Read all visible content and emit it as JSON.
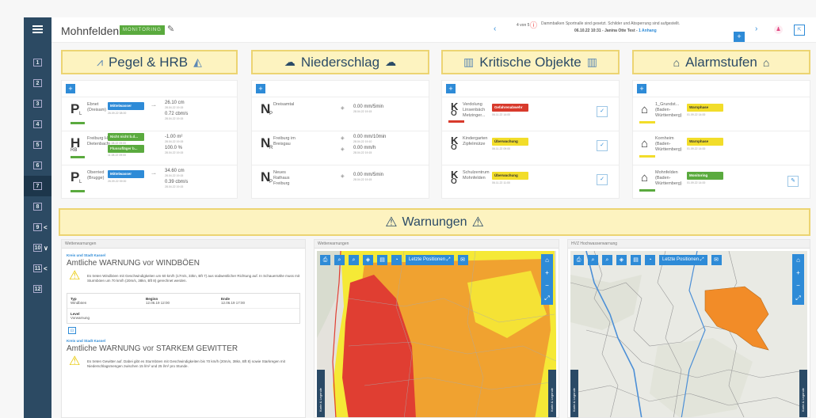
{
  "sidebar": {
    "items": [
      {
        "label": "1",
        "chevron": ""
      },
      {
        "label": "2",
        "chevron": ""
      },
      {
        "label": "3",
        "chevron": ""
      },
      {
        "label": "4",
        "chevron": ""
      },
      {
        "label": "5",
        "chevron": ""
      },
      {
        "label": "6",
        "chevron": ""
      },
      {
        "label": "7",
        "chevron": ""
      },
      {
        "label": "8",
        "chevron": ""
      },
      {
        "label": "9",
        "chevron": "<"
      },
      {
        "label": "10",
        "chevron": "∨"
      },
      {
        "label": "11",
        "chevron": "<"
      },
      {
        "label": "12",
        "chevron": ""
      }
    ]
  },
  "header": {
    "site_title": "Mohnfelden",
    "mode_badge": "MONITORING",
    "message_counter": "4 von 5",
    "message_text": "Dammbalken Sportnalle sind gesetzt. Schilder und Absperrung sind aufgestellt.",
    "message_meta": "06.10.22 10:31 - Janina Otte Test -",
    "message_link": "1 Anhang"
  },
  "categories": {
    "pegel": "Pegel & HRB",
    "niederschlag": "Niederschlag",
    "objekte": "Kritische Objekte",
    "alarm": "Alarmstufen"
  },
  "pegel": [
    {
      "letter": "P",
      "sub": "L",
      "name": "Ebnet",
      "region": "(Dreisam)",
      "badge": "Mittelwasser",
      "badge_date": "26.09.22 08:00",
      "v1": "26.10 cm",
      "d1": "28.04.22 19:15",
      "v2": "0.72 cbm/s",
      "d2": "28.04.22 19:15"
    },
    {
      "letter": "H",
      "sub": "RB",
      "name": "Freiburg HRB",
      "region": "Dietenbach",
      "badge": "Nicht nicht b.d...",
      "badge_date": "11.08.22 09:00",
      "badge2": "Flussufläger b...",
      "badge2_date": "11.08.22 09:00",
      "v1": "-1.00 m²",
      "d1": "28.04.22 19:15",
      "v2": "100.0 %",
      "d2": "28.04.22 19:15"
    },
    {
      "letter": "P",
      "sub": "L",
      "name": "Oberried",
      "region": "(Brugge)",
      "badge": "Mittelwasser",
      "badge_date": "26.09.22 09:00",
      "v1": "34.60 cm",
      "d1": "28.04.22 19:15",
      "v2": "0.39 cbm/s",
      "d2": "28.04.22 19:15"
    }
  ],
  "niederschlag": [
    {
      "letter": "N",
      "sub": "P",
      "name": "Dreisamtal",
      "v1": "0.00 mm/5min",
      "d1": "28.04.22 19:15",
      "v2": "",
      "d2": ""
    },
    {
      "letter": "N",
      "sub": "R",
      "name": "Freiburg im Breisgau",
      "v1": "0.00 mm/10min",
      "d1": "28.04.22 19:10",
      "v2": "0.00 mm/h",
      "d2": "28.04.22 19:15"
    },
    {
      "letter": "N",
      "sub": "P",
      "name": "Neues Rathaus Freiburg",
      "v1": "0.00 mm/5min",
      "d1": "28.04.22 19:15",
      "v2": "",
      "d2": ""
    }
  ],
  "objekte": [
    {
      "letter": "K",
      "sub": "O",
      "name": "Verdolung Linsenbäch Metzinger...",
      "badge": "Gefahrenabwehr",
      "badge_date": "06.11.22 14:00",
      "bar": "#d83a2c"
    },
    {
      "letter": "K",
      "sub": "O",
      "name": "Kindergarten Zipfelmütze",
      "badge": "Überwachung",
      "badge_date": "06.11.22 09:00",
      "bar": "#e8c700"
    },
    {
      "letter": "K",
      "sub": "O",
      "name": "Schulzentrum Mohnfelden",
      "badge": "Überwachung",
      "badge_date": "06.11.22 11:00",
      "bar": "#e8c700"
    }
  ],
  "alarm": [
    {
      "name": "1_Grundst... (Baden-Württemberg)",
      "badge": "Warnphase",
      "badge_date": "01.09.22 14:00",
      "color": "#f2dd2a"
    },
    {
      "name": "Kornheim (Baden-Württemberg)",
      "badge": "Warnphase",
      "badge_date": "01.09.22 14:00",
      "color": "#f2dd2a"
    },
    {
      "name": "Mohnfelden (Baden-Württemberg)",
      "badge": "Monitoring",
      "badge_date": "01.09.22 14:00",
      "color": "#5aaa3e"
    }
  ],
  "warnungen": {
    "title": "Warnungen"
  },
  "dwd": {
    "header": "Wetterwarnungen",
    "src1": "Kreis und Stadt Kassel",
    "title1": "Amtliche WARNUNG vor WINDBÖEN",
    "text1": "Es treten Windböen mit Geschwindigkeiten um 60 km/h (17m/s, 33kn, Bft 7) aus südwestlicher Richtung auf. In Schauernähe muss mit Sturmböen um 70 km/h (20m/s, 38kn, Bft 8) gerechnet werden.",
    "col_typ": "Typ",
    "col_beginn": "Beginn",
    "col_ende": "Ende",
    "val_typ": "Windböen",
    "val_beginn": "12.06.19 12:00",
    "val_ende": "12.06.19 17:00",
    "col_level": "Level",
    "val_level": "Vorwarnung",
    "src2": "Kreis und Stadt Kassel",
    "title2": "Amtliche WARNUNG vor STARKEM GEWITTER",
    "text2": "Es treten Gewitter auf. Dabei gibt es Sturmböen mit Geschwindigkeiten bis 70 km/h (20m/s, 38kn, Bft 8) sowie Starkregen mit Niederschlagsmengen zwischen 15 l/m² und 25 l/m² pro Stunde."
  },
  "map1": {
    "header": "Wetterwarnungen",
    "button": "Letzte Positionen",
    "tab": "Karte & Legende"
  },
  "map2": {
    "header": "HVZ Hochwasserwarnung",
    "button": "Letzte Positionen",
    "tab": "Karte & Legende"
  },
  "colors": {
    "accent": "#2e8bd7",
    "sidebar": "#2c4a63",
    "category_bg": "#fdf3c0",
    "monitoring": "#5aaa3e",
    "warning_red": "#e03e32",
    "warning_orange": "#f28c28",
    "warning_yellow": "#f5e936"
  }
}
